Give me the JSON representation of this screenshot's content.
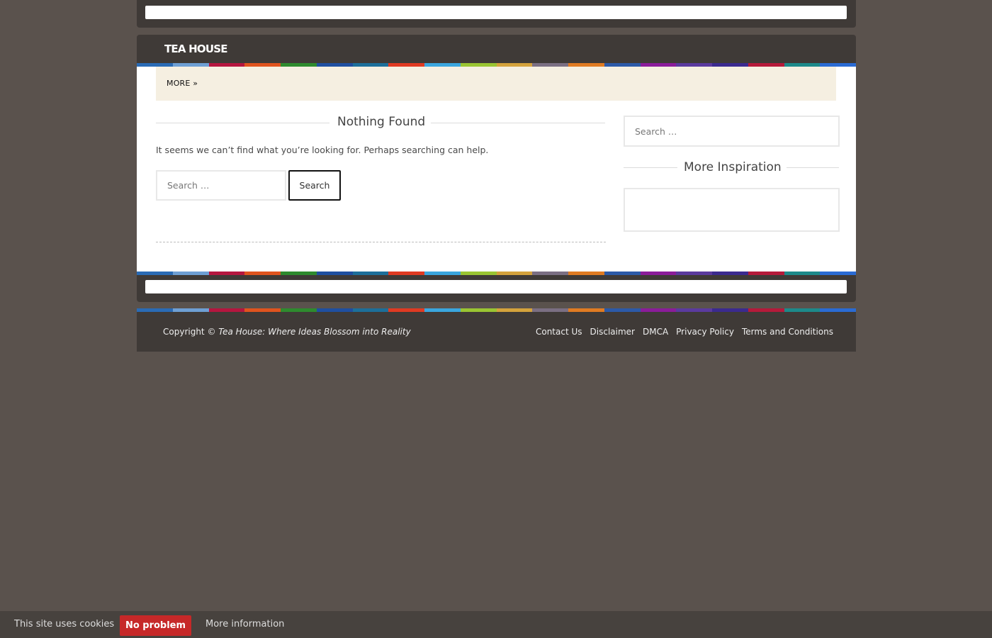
{
  "site": {
    "title": "TEA HOUSE"
  },
  "nav": {
    "more_label": "MORE »"
  },
  "main": {
    "heading": "Nothing Found",
    "message": "It seems we can’t find what you’re looking for. Perhaps searching can help.",
    "search_placeholder": "Search …",
    "search_button": "Search"
  },
  "sidebar": {
    "search_placeholder": "Search …",
    "inspiration_heading": "More Inspiration"
  },
  "footer": {
    "copyright_prefix": "Copyright © ",
    "copyright_site": "Tea House: Where Ideas Blossom into Reality",
    "links": [
      "Contact Us",
      "Disclaimer",
      "DMCA",
      "Privacy Policy",
      "Terms and Conditions"
    ]
  },
  "cookie": {
    "text": "This site uses cookies",
    "accept_label": "No problem",
    "more_label": "More information"
  },
  "colors": {
    "background": "#5a524d",
    "bar": "#3f3a37",
    "nav_bg": "#f5efe1",
    "cookie_button": "#c62828",
    "stripe": [
      "#2a6bb5",
      "#6e9fd4",
      "#b5163f",
      "#e0541e",
      "#2e8b2e",
      "#1f4fa0",
      "#1d6f9a",
      "#e03a22",
      "#3aa6de",
      "#9ac532",
      "#d4a23c",
      "#7b6f83",
      "#e07b22",
      "#2c5aa8",
      "#8b1c9a",
      "#5b3a9e",
      "#3b2a8f",
      "#b51a3a",
      "#1d8a8a",
      "#2a6bd4"
    ]
  }
}
